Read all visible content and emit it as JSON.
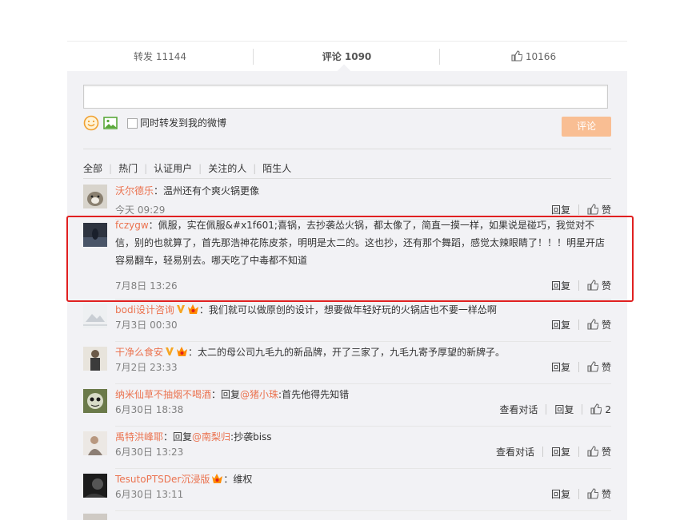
{
  "tabs": {
    "repost_label": "转发 11144",
    "comment_label": "评论 1090",
    "like_label": "10166"
  },
  "composer": {
    "input_value": "",
    "repost_also_label": "同时转发到我的微博",
    "submit_label": "评论"
  },
  "filters": [
    "全部",
    "热门",
    "认证用户",
    "关注的人",
    "陌生人"
  ],
  "actions": {
    "reply": "回复",
    "like": "赞",
    "view_conversation": "查看对话"
  },
  "comments": [
    {
      "username": "沃尔德乐",
      "text": "：温州还有个爽火锅更像",
      "time": "今天 09:29"
    },
    {
      "username": "fczygw",
      "text": "：佩服，实在佩服&#x1f601;喜锅，去抄袭怂火锅，都太像了，简直一摸一样，如果说是碰巧，我觉对不信，别的也就算了，首先那浩神花陈皮茶，明明是太二的。这也抄，还有那个舞蹈，感觉太辣眼睛了！！！明星开店容易翻车，轻易别去。哪天吃了中毒都不知道",
      "time": "7月8日 13:26"
    },
    {
      "username": "bodi设计咨询",
      "text": "：我们就可以做原创的设计，想要做年轻好玩的火锅店也不要一样怂啊",
      "time": "7月3日 00:30"
    },
    {
      "username": "干净么食安",
      "text": "：太二的母公司九毛九的新品牌，开了三家了，九毛九寄予厚望的新牌子。",
      "time": "7月2日 23:33"
    },
    {
      "username": "纳米仙草不抽烟不喝酒",
      "text_prefix": "：回复",
      "mention": "@猪小珠",
      "text_suffix": ":首先他得先知错",
      "time": "6月30日 18:38",
      "like_count": "2"
    },
    {
      "username": "禹特洪峰耶",
      "text_prefix": "：回复",
      "mention": "@南梨归",
      "text_suffix": ":抄袭biss",
      "time": "6月30日 13:23"
    },
    {
      "username": "TesutoPTSDer沉浸版",
      "text": "：维权",
      "time": "6月30日 13:11"
    }
  ],
  "colors": {
    "accent": "#eb7350",
    "submit_bg": "#f9be93",
    "highlight_border": "#e02020",
    "panel_bg": "#f2f2f5",
    "verified_v": "#f5a623"
  }
}
